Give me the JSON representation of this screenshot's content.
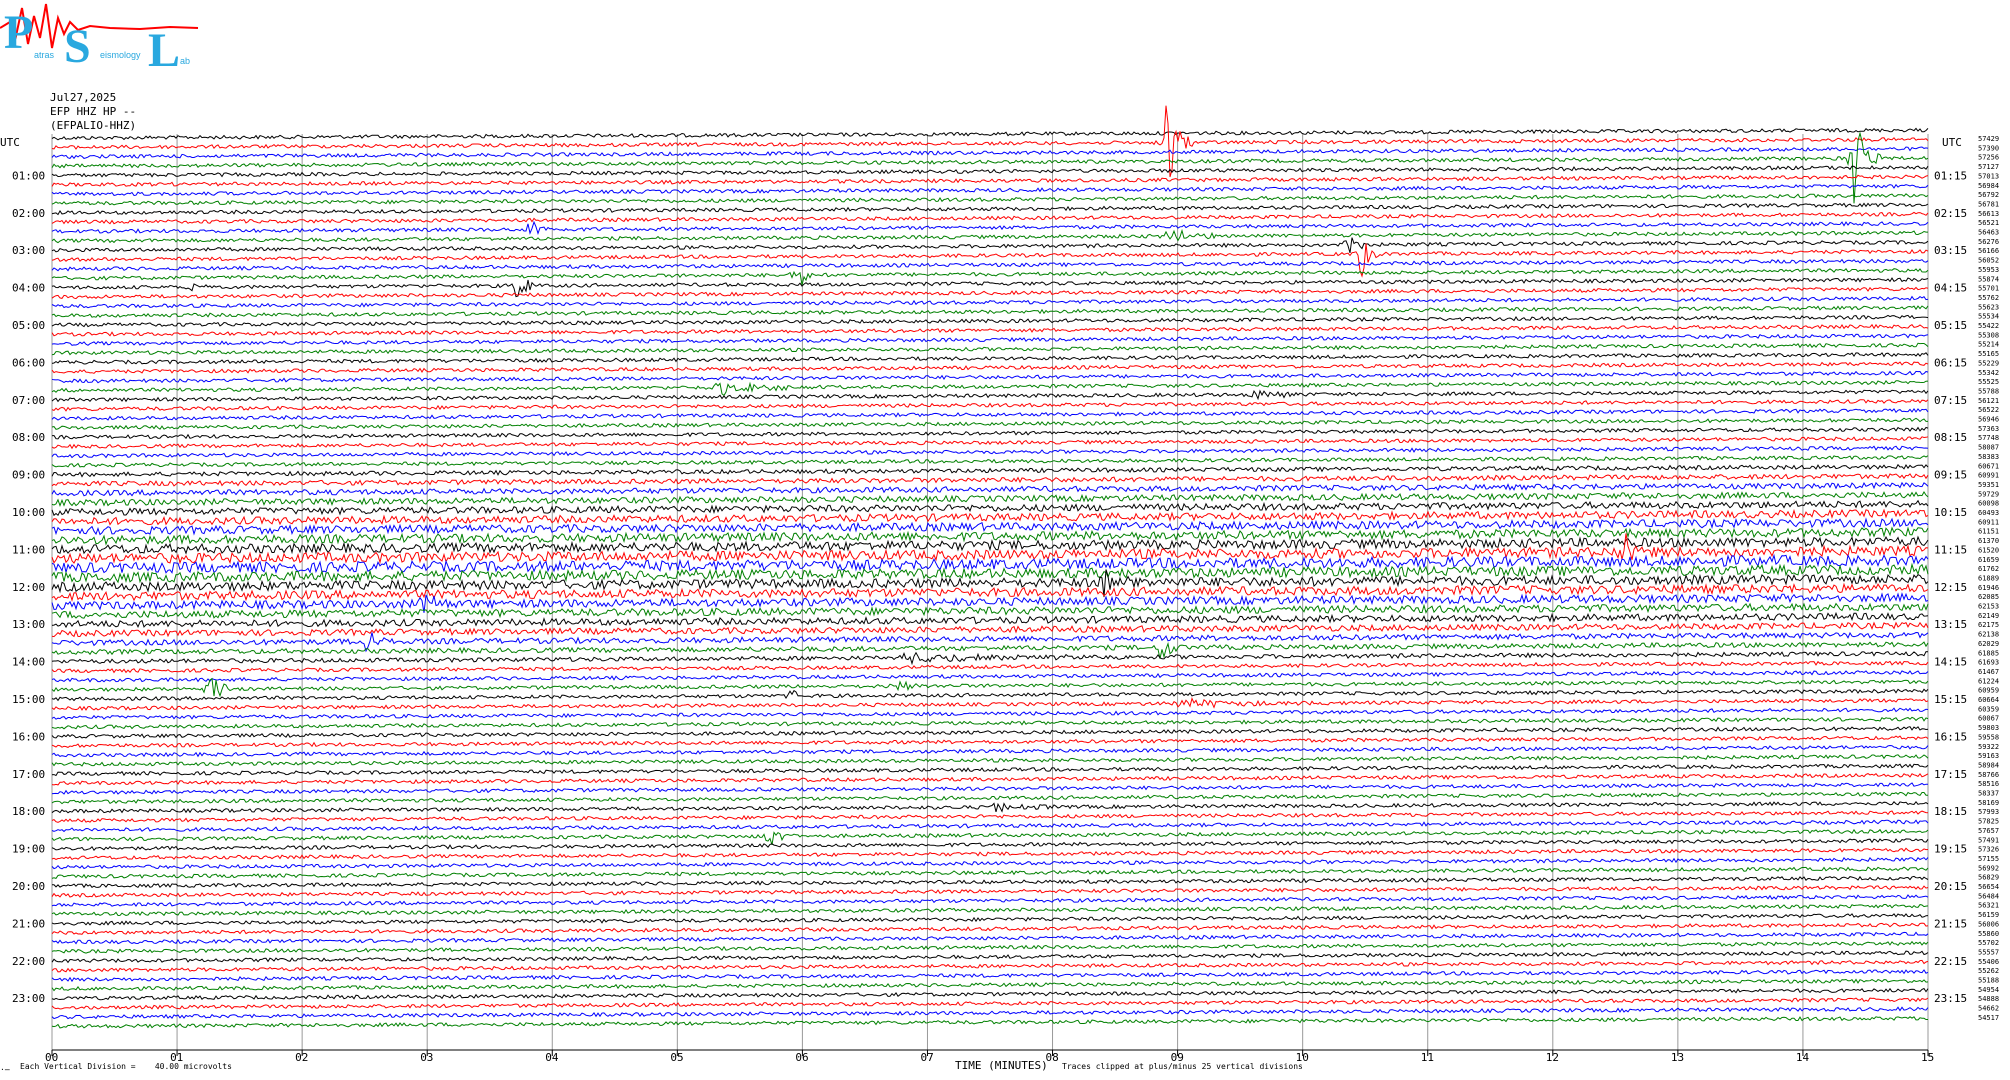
{
  "logo": {
    "letters": [
      "P",
      "S",
      "L"
    ],
    "subtext": [
      "atras",
      "eismology",
      "ab"
    ]
  },
  "header": {
    "date": "Jul27,2025",
    "station": "EFP HHZ HP --",
    "channel": "(EFPALIO-HHZ)"
  },
  "footer": {
    "scale_note": "Each Vertical Division =    40.00 microvolts",
    "axis_title": "TIME (MINUTES)",
    "clip_note": "Traces clipped at plus/minus 25 vertical divisions",
    "corner_mark": "·̶"
  },
  "chart_data": {
    "type": "line",
    "title": "",
    "xlabel": "TIME (MINUTES)",
    "ylabel": "",
    "x_ticks": [
      "00",
      "01",
      "02",
      "03",
      "04",
      "05",
      "06",
      "07",
      "08",
      "09",
      "10",
      "11",
      "12",
      "13",
      "14",
      "15"
    ],
    "xlim": [
      0,
      15
    ],
    "left_axis_title": "UTC",
    "right_axis_title": "UTC",
    "left_hour_labels": [
      "01:00",
      "02:00",
      "03:00",
      "04:00",
      "05:00",
      "06:00",
      "07:00",
      "08:00",
      "09:00",
      "10:00",
      "11:00",
      "12:00",
      "13:00",
      "14:00",
      "15:00",
      "16:00",
      "17:00",
      "18:00",
      "19:00",
      "20:00",
      "21:00",
      "22:00",
      "23:00"
    ],
    "right_hour_labels": [
      "01:15",
      "02:15",
      "03:15",
      "04:15",
      "05:15",
      "06:15",
      "07:15",
      "08:15",
      "09:15",
      "10:15",
      "11:15",
      "12:15",
      "13:15",
      "14:15",
      "15:15",
      "16:15",
      "17:15",
      "18:15",
      "19:15",
      "20:15",
      "21:15",
      "22:15",
      "23:15"
    ],
    "trace_colors": [
      "#000000",
      "#ff0000",
      "#0000ff",
      "#008000"
    ],
    "trace_count": 96,
    "minutes_per_trace": 15,
    "vertical_gridlines_every_min": 1,
    "right_trace_values": [
      "57429",
      "57390",
      "57256",
      "57127",
      "57013",
      "56984",
      "56792",
      "56781",
      "56613",
      "56521",
      "56463",
      "56276",
      "56166",
      "56052",
      "55953",
      "55874",
      "55701",
      "55762",
      "55623",
      "55534",
      "55422",
      "55308",
      "55214",
      "55165",
      "55229",
      "55342",
      "55525",
      "55788",
      "56121",
      "56522",
      "56946",
      "57363",
      "57748",
      "58087",
      "58383",
      "60671",
      "60991",
      "59351",
      "59729",
      "60098",
      "60493",
      "60911",
      "61151",
      "61370",
      "61520",
      "61659",
      "61762",
      "61889",
      "61946",
      "62085",
      "62153",
      "62149",
      "62175",
      "62138",
      "62029",
      "61885",
      "61693",
      "61467",
      "61224",
      "60959",
      "60664",
      "60359",
      "60067",
      "59803",
      "59558",
      "59322",
      "59163",
      "58984",
      "58766",
      "58516",
      "58337",
      "58169",
      "57993",
      "57825",
      "57657",
      "57491",
      "57326",
      "57155",
      "56992",
      "56829",
      "56654",
      "56484",
      "56321",
      "56159",
      "56006",
      "55860",
      "55702",
      "55557",
      "55406",
      "55262",
      "55188",
      "54954",
      "54888",
      "54662",
      "54517"
    ],
    "events": [
      {
        "row": 1,
        "minute": 8.9,
        "amp": 60,
        "len": 0.25
      },
      {
        "row": 3,
        "minute": 14.4,
        "amp": 55,
        "len": 0.25
      },
      {
        "row": 10,
        "minute": 3.8,
        "amp": 10,
        "len": 0.4
      },
      {
        "row": 11,
        "minute": 8.9,
        "amp": 8,
        "len": 0.6
      },
      {
        "row": 12,
        "minute": 10.3,
        "amp": 25,
        "len": 0.25
      },
      {
        "row": 13,
        "minute": 10.45,
        "amp": 30,
        "len": 0.2
      },
      {
        "row": 16,
        "minute": 3.7,
        "amp": 28,
        "len": 0.2
      },
      {
        "row": 16,
        "minute": 1.1,
        "amp": 8,
        "len": 0.2
      },
      {
        "row": 15,
        "minute": 5.95,
        "amp": 24,
        "len": 0.2
      },
      {
        "row": 27,
        "minute": 5.3,
        "amp": 8,
        "len": 1.0
      },
      {
        "row": 28,
        "minute": 9.6,
        "amp": 6,
        "len": 0.5
      },
      {
        "row": 45,
        "minute": 12.55,
        "amp": 40,
        "len": 0.2
      },
      {
        "row": 48,
        "minute": 8.4,
        "amp": 20,
        "len": 0.3
      },
      {
        "row": 50,
        "minute": 2.95,
        "amp": 24,
        "len": 0.25
      },
      {
        "row": 54,
        "minute": 2.5,
        "amp": 18,
        "len": 0.3
      },
      {
        "row": 55,
        "minute": 8.85,
        "amp": 18,
        "len": 0.3
      },
      {
        "row": 56,
        "minute": 6.8,
        "amp": 6,
        "len": 1.8
      },
      {
        "row": 59,
        "minute": 1.25,
        "amp": 20,
        "len": 0.25
      },
      {
        "row": 59,
        "minute": 6.75,
        "amp": 10,
        "len": 0.2
      },
      {
        "row": 60,
        "minute": 5.9,
        "amp": 10,
        "len": 0.15
      },
      {
        "row": 61,
        "minute": 9.0,
        "amp": 6,
        "len": 1.3
      },
      {
        "row": 72,
        "minute": 7.5,
        "amp": 6,
        "len": 0.7
      },
      {
        "row": 75,
        "minute": 5.7,
        "amp": 18,
        "len": 0.3
      }
    ]
  }
}
